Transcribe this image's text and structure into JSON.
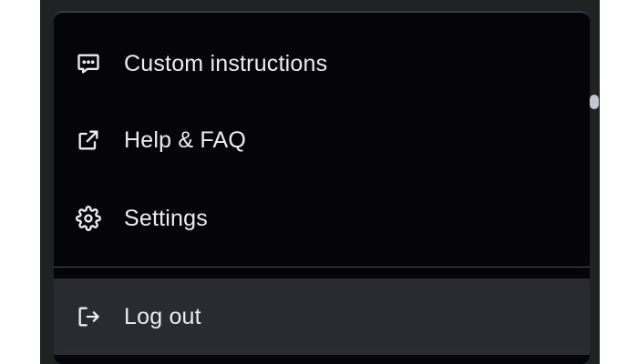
{
  "menu": {
    "items": [
      {
        "label": "Custom instructions",
        "icon": "chat-bubble-icon"
      },
      {
        "label": "Help & FAQ",
        "icon": "external-link-icon"
      },
      {
        "label": "Settings",
        "icon": "gear-icon"
      }
    ],
    "logout": {
      "label": "Log out",
      "icon": "logout-icon"
    }
  },
  "colors": {
    "menu_bg": "#050509",
    "hover_bg": "#2a2b32",
    "text": "#ececf1",
    "shell_bg": "#202123"
  }
}
